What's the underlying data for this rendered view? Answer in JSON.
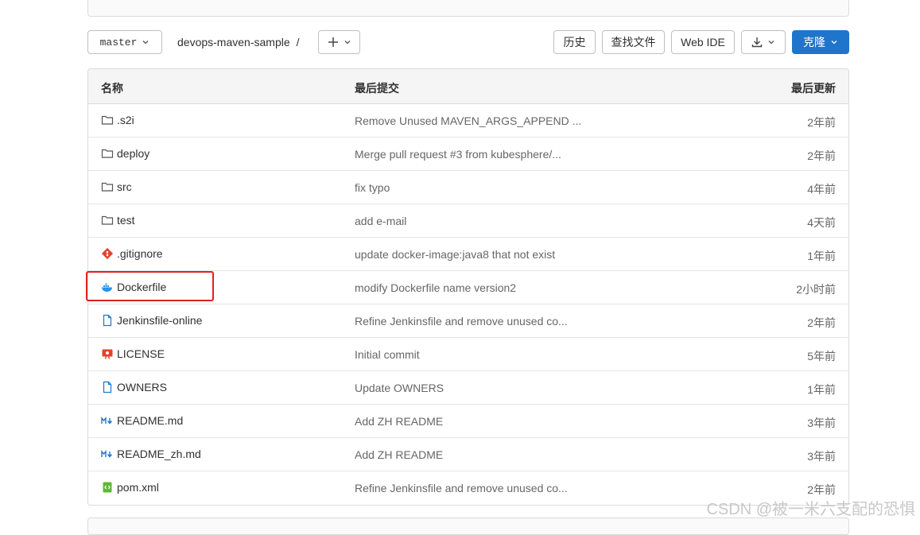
{
  "toolbar": {
    "branch": "master",
    "repo": "devops-maven-sample",
    "sep": "/",
    "add_icon": "plus-icon",
    "history": "历史",
    "find_file": "查找文件",
    "web_ide": "Web IDE",
    "download_icon": "download-icon",
    "clone": "克隆"
  },
  "table": {
    "headers": {
      "name": "名称",
      "commit": "最后提交",
      "updated": "最后更新"
    },
    "rows": [
      {
        "name": ".s2i",
        "icon": "folder-icon",
        "commit": "Remove Unused MAVEN_ARGS_APPEND ...",
        "time": "2年前"
      },
      {
        "name": "deploy",
        "icon": "folder-icon",
        "commit": "Merge pull request #3 from kubesphere/...",
        "time": "2年前"
      },
      {
        "name": "src",
        "icon": "folder-icon",
        "commit": "fix typo",
        "time": "4年前"
      },
      {
        "name": "test",
        "icon": "folder-icon",
        "commit": "add e-mail",
        "time": "4天前"
      },
      {
        "name": ".gitignore",
        "icon": "git-icon",
        "commit": "update docker-image:java8 that not exist",
        "time": "1年前"
      },
      {
        "name": "Dockerfile",
        "icon": "docker-icon",
        "commit": "modify Dockerfile name version2",
        "time": "2小时前"
      },
      {
        "name": "Jenkinsfile-online",
        "icon": "file-icon",
        "commit": "Refine Jenkinsfile and remove unused co...",
        "time": "2年前"
      },
      {
        "name": "LICENSE",
        "icon": "license-icon",
        "commit": "Initial commit",
        "time": "5年前"
      },
      {
        "name": "OWNERS",
        "icon": "file-icon",
        "commit": "Update OWNERS",
        "time": "1年前"
      },
      {
        "name": "README.md",
        "icon": "markdown-icon",
        "commit": "Add ZH README",
        "time": "3年前"
      },
      {
        "name": "README_zh.md",
        "icon": "markdown-icon",
        "commit": "Add ZH README",
        "time": "3年前"
      },
      {
        "name": "pom.xml",
        "icon": "xml-icon",
        "commit": "Refine Jenkinsfile and remove unused co...",
        "time": "2年前"
      }
    ]
  },
  "watermark": "CSDN @被一米六支配的恐惧",
  "colors": {
    "accent": "#1f75cb",
    "highlight": "#e02020",
    "git": "#e24329",
    "docker": "#2496ed",
    "file": "#1f75cb",
    "xml": "#5fb832"
  }
}
